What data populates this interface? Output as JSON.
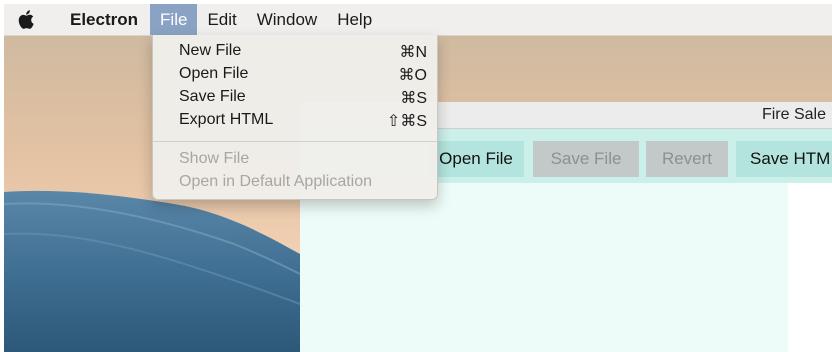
{
  "menubar": {
    "apple_icon": "apple-logo",
    "app_name": "Electron",
    "menus": [
      {
        "label": "File",
        "active": true
      },
      {
        "label": "Edit",
        "active": false
      },
      {
        "label": "Window",
        "active": false
      },
      {
        "label": "Help",
        "active": false
      }
    ]
  },
  "file_menu": {
    "items": [
      {
        "label": "New File",
        "shortcut": "⌘N",
        "enabled": true
      },
      {
        "label": "Open File",
        "shortcut": "⌘O",
        "enabled": true
      },
      {
        "label": "Save File",
        "shortcut": "⌘S",
        "enabled": true
      },
      {
        "label": "Export HTML",
        "shortcut": "⇧⌘S",
        "enabled": true
      },
      {
        "label": "Show File",
        "shortcut": "",
        "enabled": false
      },
      {
        "label": "Open in Default Application",
        "shortcut": "",
        "enabled": false
      }
    ]
  },
  "window": {
    "title": "Fire Sale",
    "toolbar": {
      "open_file": "Open File",
      "save_file": "Save File",
      "revert": "Revert",
      "save_html": "Save HTM"
    }
  },
  "colors": {
    "menu_highlight": "#8aa3c4",
    "toolbar_bg": "#cbefe9",
    "button_enabled": "#b3e4dd",
    "button_disabled": "#c3c9c8",
    "editor_bg": "#eefcf9"
  }
}
